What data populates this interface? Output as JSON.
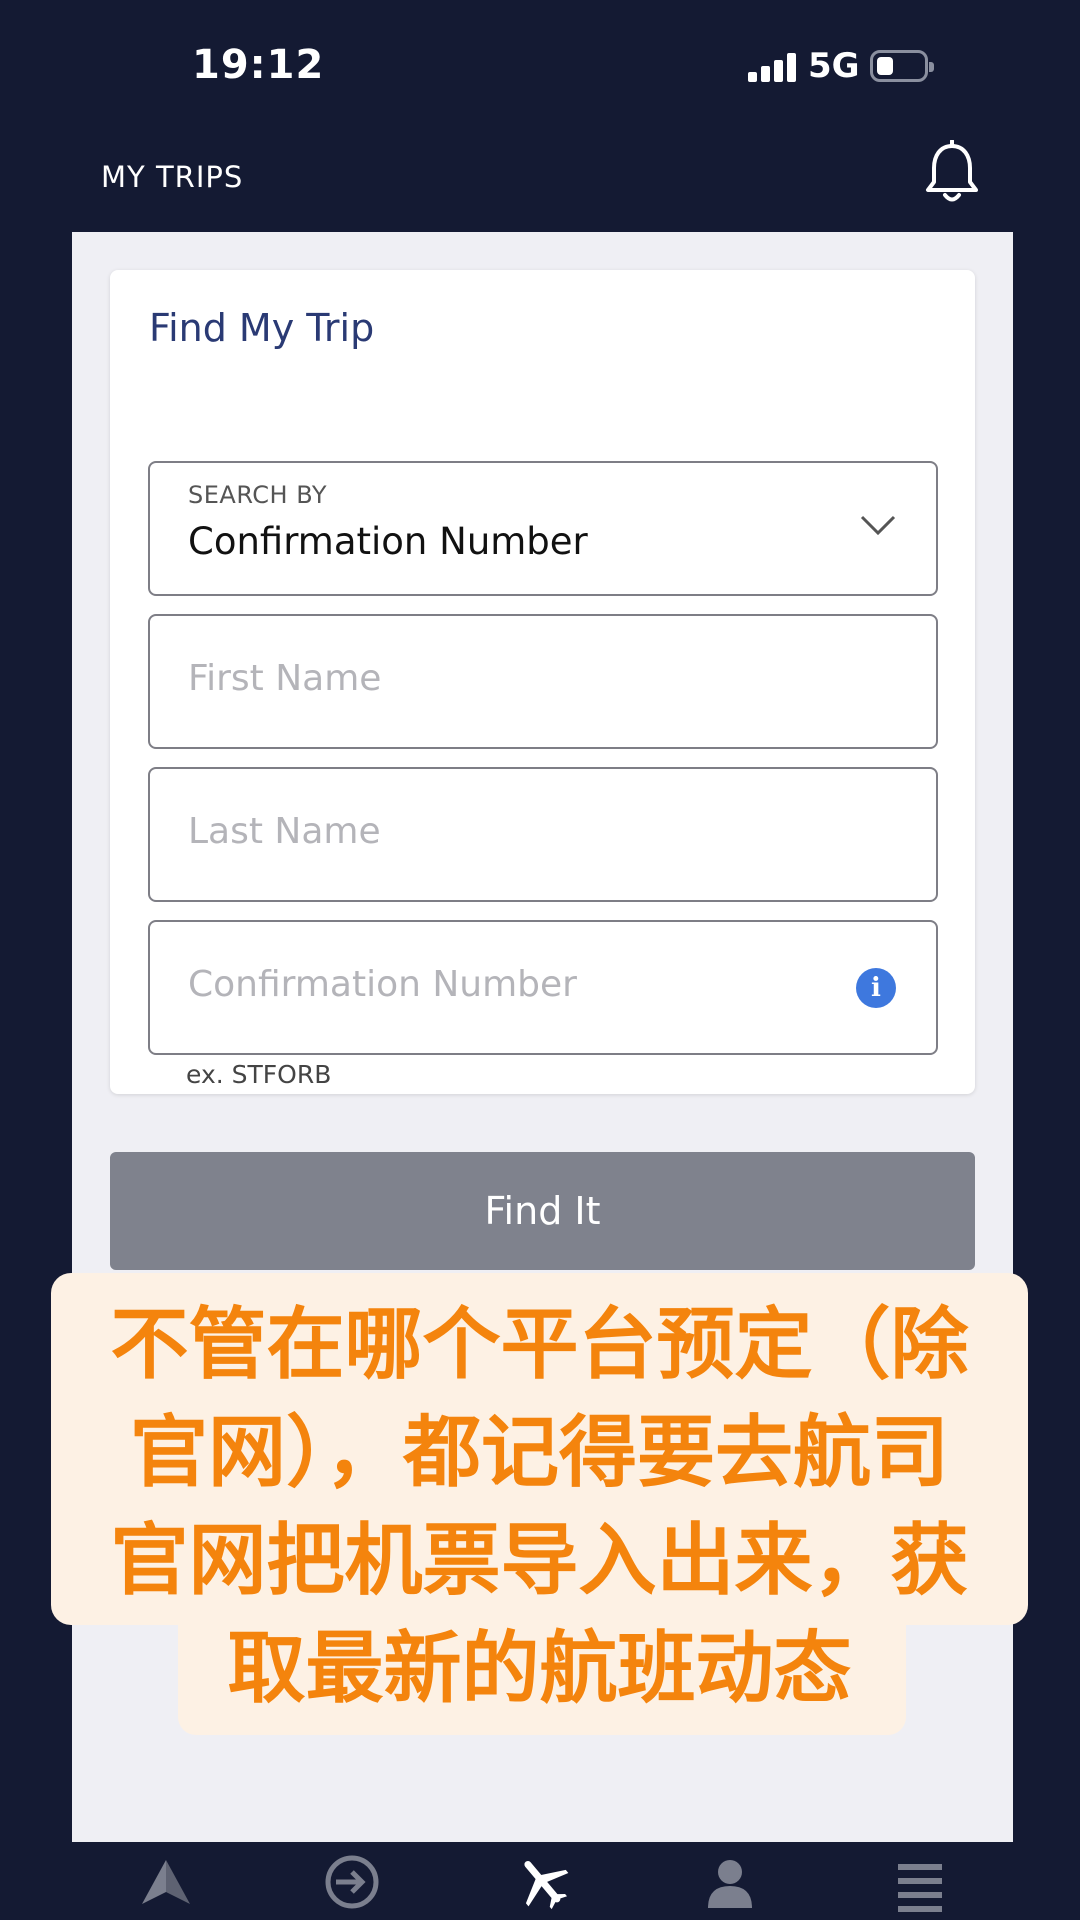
{
  "status_bar": {
    "time": "19:12",
    "network": "5G"
  },
  "header": {
    "title": "MY TRIPS",
    "notification_icon": "bell-icon"
  },
  "find_trip": {
    "title": "Find My Trip",
    "search_by": {
      "label": "SEARCH BY",
      "value": "Confirmation Number"
    },
    "first_name": {
      "placeholder": "First Name"
    },
    "last_name": {
      "placeholder": "Last Name"
    },
    "confirmation": {
      "placeholder": "Confirmation Number",
      "hint": "ex. STFORB",
      "info_icon": "i"
    },
    "button": "Find It"
  },
  "caption": {
    "lines": [
      "不管在哪个平台预定（除",
      "官网），都记得要去航司",
      "官网把机票导入出来，获",
      "取最新的航班动态"
    ]
  },
  "tabbar": {
    "items": [
      "home-logo-icon",
      "check-in-icon",
      "flight-icon",
      "profile-icon",
      "menu-icon"
    ]
  },
  "colors": {
    "background": "#141a33",
    "title": "#2a3a74",
    "button": "#7f828d",
    "info": "#3e78de",
    "caption_text": "#f4840d",
    "caption_bg": "#fdf1e4"
  }
}
